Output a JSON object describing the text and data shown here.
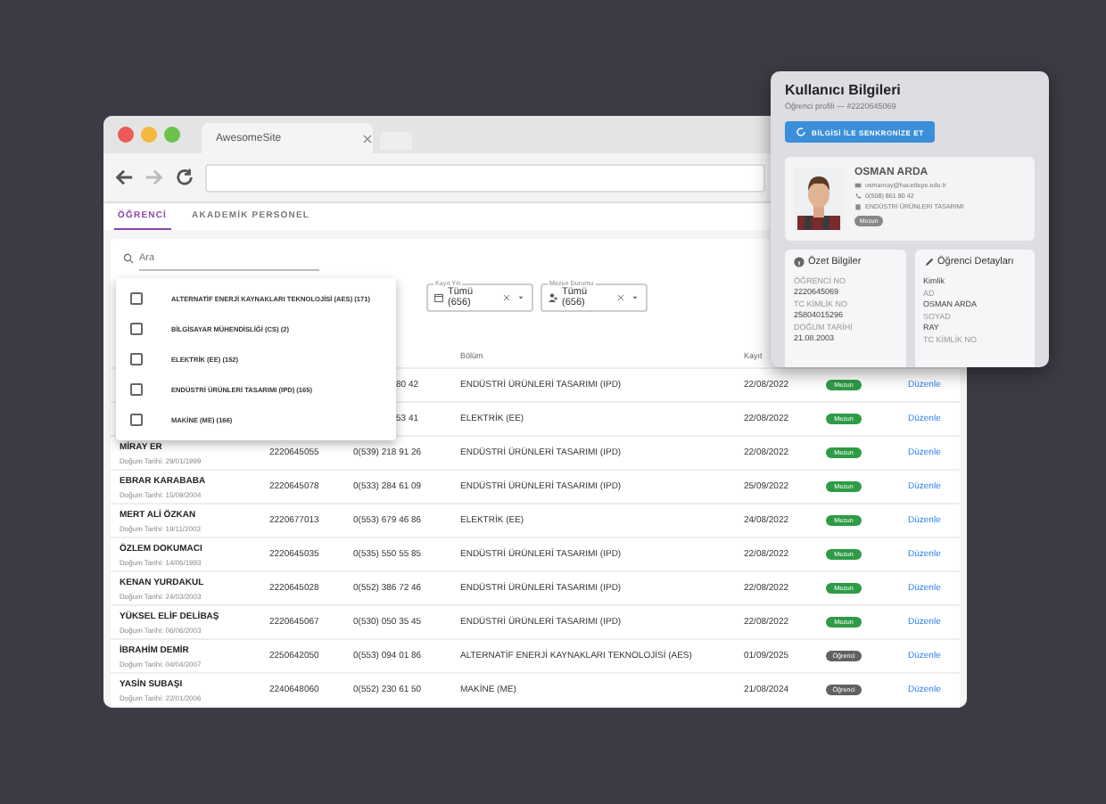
{
  "browser": {
    "tab_title": "AwesomeSite"
  },
  "tabs": [
    {
      "label": "ÖĞRENCİ",
      "selected": true
    },
    {
      "label": "AKADEMİK PERSONEL",
      "selected": false
    }
  ],
  "search": {
    "placeholder": "Ara"
  },
  "filters": [
    {
      "label": "Kayıt Yılı",
      "value": "Tümü (656)",
      "kind": "calendar"
    },
    {
      "label": "Mezun Durumu",
      "value": "Tümü (656)",
      "kind": "person"
    }
  ],
  "dropdown": {
    "options": [
      {
        "label": "ALTERNATİF ENERJİ KAYNAKLARI TEKNOLOJİSİ (AES) (171)",
        "checked": false
      },
      {
        "label": "BİLGİSAYAR MÜHENDİSLİĞİ (CS) (2)",
        "checked": false
      },
      {
        "label": "ELEKTRİK (EE) (152)",
        "checked": false
      },
      {
        "label": "ENDÜSTRİ ÜRÜNLERİ TASARIMI (IPD) (165)",
        "checked": false
      },
      {
        "label": "MAKİNE (ME) (166)",
        "checked": false
      }
    ]
  },
  "table": {
    "columns": [
      "Bölüm",
      "Kayıt"
    ],
    "rows": [
      {
        "phone": "80 42",
        "department": "ENDÜSTRİ ÜRÜNLERİ TASARIMI (IPD)",
        "date": "22/08/2022",
        "status": "Mezun",
        "color": "#2e9b46",
        "action": "Düzenle"
      },
      {
        "phone": "53 41",
        "department": "ELEKTRİK (EE)",
        "date": "22/08/2022",
        "status": "Mezun",
        "color": "#2e9b46",
        "action": "Düzenle"
      },
      {
        "name": "MİRAY ER",
        "birth": "Doğum Tarihi: 29/01/1999",
        "id": "2220645055",
        "phone": "0(539) 218 91 26",
        "department": "ENDÜSTRİ ÜRÜNLERİ TASARIMI (IPD)",
        "date": "22/08/2022",
        "status": "Mezun",
        "color": "#2e9b46",
        "action": "Düzenle"
      },
      {
        "name": "EBRAR KARABABA",
        "birth": "Doğum Tarihi: 15/09/2004",
        "id": "2220645078",
        "phone": "0(533) 284 61 09",
        "department": "ENDÜSTRİ ÜRÜNLERİ TASARIMI (IPD)",
        "date": "25/09/2022",
        "status": "Mezun",
        "color": "#2e9b46",
        "action": "Düzenle"
      },
      {
        "name": "MERT ALİ ÖZKAN",
        "birth": "Doğum Tarihi: 19/11/2003",
        "id": "2220677013",
        "phone": "0(553) 679 46 86",
        "department": "ELEKTRİK (EE)",
        "date": "24/08/2022",
        "status": "Mezun",
        "color": "#2e9b46",
        "action": "Düzenle"
      },
      {
        "name": "ÖZLEM DOKUMACI",
        "birth": "Doğum Tarihi: 14/06/1993",
        "id": "2220645035",
        "phone": "0(535) 550 55 85",
        "department": "ENDÜSTRİ ÜRÜNLERİ TASARIMI (IPD)",
        "date": "22/08/2022",
        "status": "Mezun",
        "color": "#2e9b46",
        "action": "Düzenle"
      },
      {
        "name": "KENAN YURDAKUL",
        "birth": "Doğum Tarihi: 24/03/2003",
        "id": "2220645028",
        "phone": "0(552) 386 72 46",
        "department": "ENDÜSTRİ ÜRÜNLERİ TASARIMI (IPD)",
        "date": "22/08/2022",
        "status": "Mezun",
        "color": "#2e9b46",
        "action": "Düzenle"
      },
      {
        "name": "YÜKSEL ELİF DELİBAŞ",
        "birth": "Doğum Tarihi: 06/06/2003",
        "id": "2220645067",
        "phone": "0(530) 050 35 45",
        "department": "ENDÜSTRİ ÜRÜNLERİ TASARIMI (IPD)",
        "date": "22/08/2022",
        "status": "Mezun",
        "color": "#2e9b46",
        "action": "Düzenle"
      },
      {
        "name": "İBRAHİM DEMİR",
        "birth": "Doğum Tarihi: 04/04/2007",
        "id": "2250642050",
        "phone": "0(553) 094 01 86",
        "department": "ALTERNATİF ENERJİ KAYNAKLARI TEKNOLOJİSİ (AES)",
        "date": "01/09/2025",
        "status": "Öğrenci",
        "color": "#616161",
        "action": "Düzenle"
      },
      {
        "name": "YASİN SUBAŞI",
        "birth": "Doğum Tarihi: 22/01/2006",
        "id": "2240648060",
        "phone": "0(552) 230 61 50",
        "department": "MAKİNE (ME)",
        "date": "21/08/2024",
        "status": "Öğrenci",
        "color": "#616161",
        "action": "Düzenle"
      }
    ]
  },
  "panel": {
    "title": "Kullanıcı Bilgileri",
    "subtitle": "Öğrenci profili — #2220645069",
    "sync_button": "BİLGİSİ İLE SENKRONİZE ET",
    "profile": {
      "name": "OSMAN ARDA",
      "email": "osmanray@hacettepe.edu.tr",
      "phone": "0(508) 861 80 42",
      "department": "ENDÜSTRİ ÜRÜNLERİ TASARIMI",
      "status": "Mezun"
    },
    "summary": {
      "title": "Özet Bilgiler",
      "fields": [
        {
          "label": "ÖĞRENCİ NO",
          "value": "2220645069"
        },
        {
          "label": "TC KİMLİK NO",
          "value": "25804015296"
        },
        {
          "label": "DOĞUM TARİHİ",
          "value": "21.08.2003"
        }
      ]
    },
    "details": {
      "title": "Öğrenci Detayları",
      "section": "Kimlik",
      "fields": [
        {
          "label": "AD",
          "value": "OSMAN ARDA"
        },
        {
          "label": "SOYAD",
          "value": "RAY"
        },
        {
          "label": "TC KİMLİK NO"
        }
      ]
    }
  }
}
